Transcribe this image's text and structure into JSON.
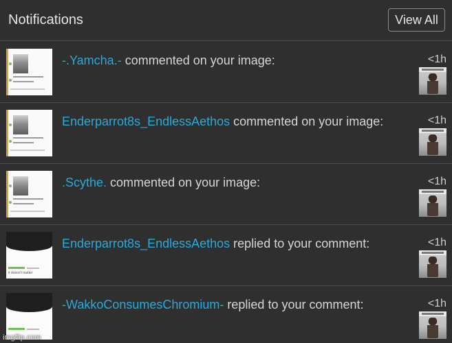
{
  "header": {
    "title": "Notifications",
    "view_all_label": "View All"
  },
  "notifications": [
    {
      "user": "-.Yamcha.-",
      "action": "commented on your image:",
      "time": "<1h",
      "thumbnail": "meme-screenshot-thumbnail",
      "target_image": "image-thumbnail"
    },
    {
      "user": "Enderparrot8s_EndlessAethos",
      "action": "commented on your image:",
      "time": "<1h",
      "thumbnail": "meme-screenshot-thumbnail",
      "target_image": "image-thumbnail"
    },
    {
      "user": ".Scythe.",
      "action": "commented on your image:",
      "time": "<1h",
      "thumbnail": "meme-screenshot-thumbnail",
      "target_image": "image-thumbnail"
    },
    {
      "user": "Enderparrot8s_EndlessAethos",
      "action": "replied to your comment:",
      "time": "<1h",
      "thumbnail": "comment-thumbnail",
      "thumb_caption": "it doesn't matter",
      "target_image": "image-thumbnail"
    },
    {
      "user": "-WakkoConsumesChromium-",
      "action": "replied to your comment:",
      "time": "<1h",
      "thumbnail": "comment-thumbnail",
      "target_image": "image-thumbnail"
    }
  ],
  "watermark": "imgflip.com",
  "colors": {
    "background": "#2f2f2f",
    "divider": "#4a4a4a",
    "username": "#2aaad8",
    "text": "#d6d6d6"
  }
}
